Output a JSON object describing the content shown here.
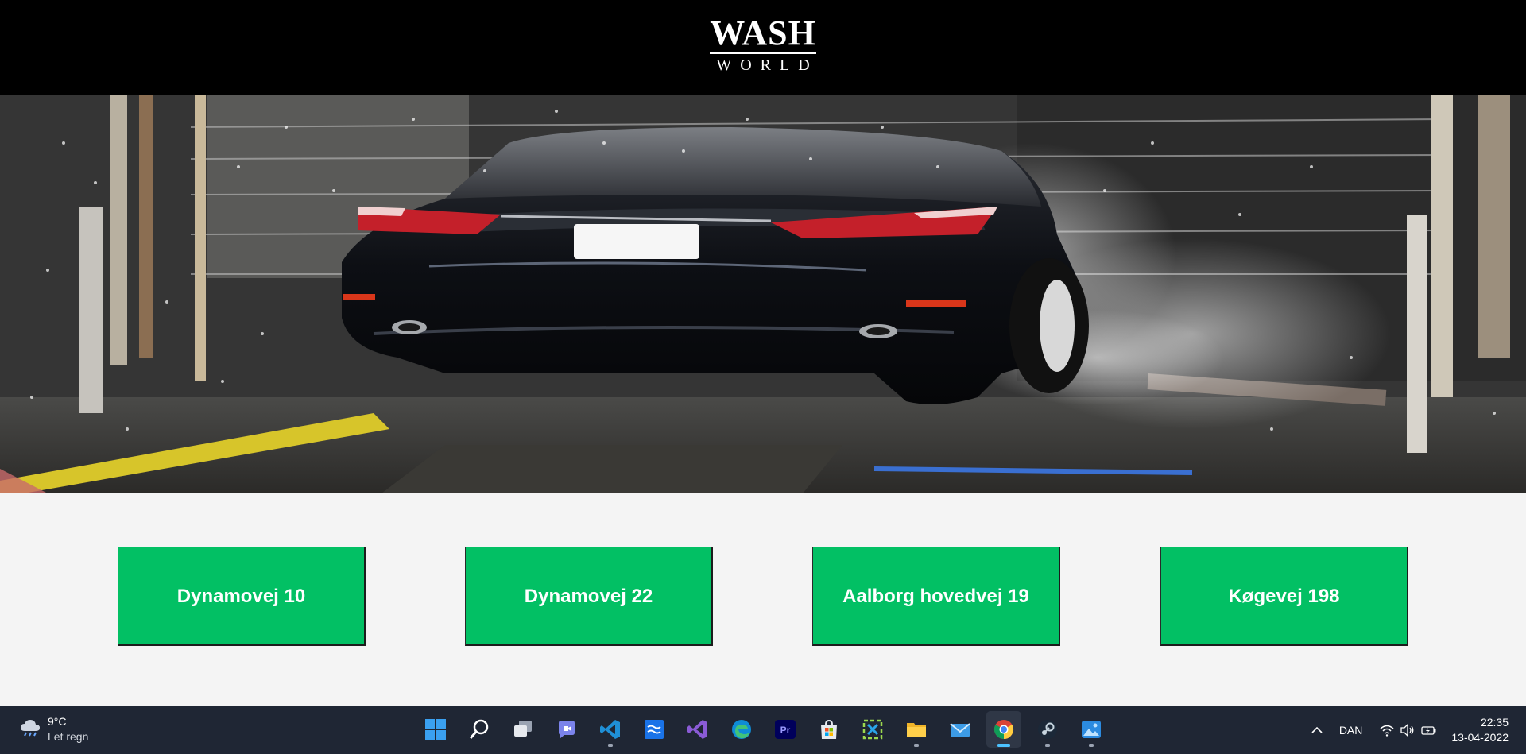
{
  "brand": {
    "logo_top": "WASH",
    "logo_bottom": "WORLD"
  },
  "hero": {
    "image": "car-wash-photo"
  },
  "locations": [
    {
      "label": "Dynamovej 10"
    },
    {
      "label": "Dynamovej 22"
    },
    {
      "label": "Aalborg hovedvej 19"
    },
    {
      "label": "Køgevej 198"
    }
  ],
  "colors": {
    "header_bg": "#000000",
    "button_bg": "#02c064",
    "page_bg": "#f4f4f4",
    "taskbar_bg": "#1f2634"
  },
  "taskbar": {
    "weather": {
      "temp": "9°C",
      "condition": "Let regn",
      "icon": "cloud-rain-icon"
    },
    "apps": [
      {
        "name": "start-icon",
        "active": false,
        "running": false
      },
      {
        "name": "search-icon",
        "active": false,
        "running": false
      },
      {
        "name": "task-view-icon",
        "active": false,
        "running": false
      },
      {
        "name": "teams-chat-icon",
        "active": false,
        "running": false
      },
      {
        "name": "vscode-icon",
        "active": false,
        "running": true
      },
      {
        "name": "azure-data-studio-icon",
        "active": false,
        "running": false
      },
      {
        "name": "visual-studio-icon",
        "active": false,
        "running": false
      },
      {
        "name": "edge-icon",
        "active": false,
        "running": false
      },
      {
        "name": "premiere-pro-icon",
        "active": false,
        "running": false
      },
      {
        "name": "microsoft-store-icon",
        "active": false,
        "running": false
      },
      {
        "name": "snipping-tool-icon",
        "active": false,
        "running": false
      },
      {
        "name": "file-explorer-icon",
        "active": false,
        "running": true
      },
      {
        "name": "mail-icon",
        "active": false,
        "running": false
      },
      {
        "name": "chrome-icon",
        "active": true,
        "running": true
      },
      {
        "name": "steam-icon",
        "active": false,
        "running": true
      },
      {
        "name": "photos-icon",
        "active": false,
        "running": true
      }
    ],
    "tray": {
      "language": "DAN",
      "time": "22:35",
      "date": "13-04-2022"
    }
  }
}
